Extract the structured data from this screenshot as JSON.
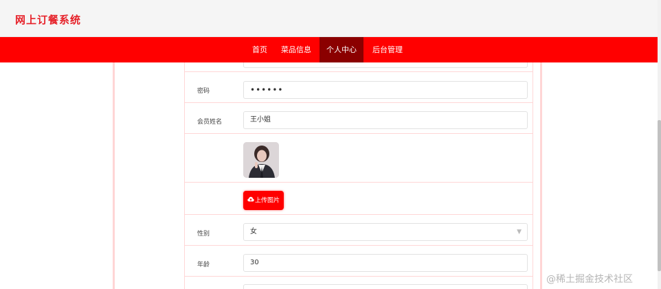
{
  "header": {
    "title": "网上订餐系统"
  },
  "nav": {
    "items": [
      {
        "label": "首页",
        "active": false
      },
      {
        "label": "菜品信息",
        "active": false
      },
      {
        "label": "个人中心",
        "active": true
      },
      {
        "label": "后台管理",
        "active": false
      }
    ]
  },
  "form": {
    "password": {
      "label": "密码",
      "value": "••••••"
    },
    "member_name": {
      "label": "会员姓名",
      "value": "王小姐"
    },
    "upload": {
      "label": "上传图片"
    },
    "gender": {
      "label": "性别",
      "value": "女"
    },
    "age": {
      "label": "年龄",
      "value": "30"
    }
  },
  "watermark": "@稀土掘金技术社区",
  "colors": {
    "primary": "#ff0000",
    "active_nav": "#8b0000",
    "brand_text": "#e62129",
    "divider": "#ffd6d6"
  },
  "icons": {
    "upload": "cloud-upload-icon",
    "select": "chevron-down-icon"
  }
}
